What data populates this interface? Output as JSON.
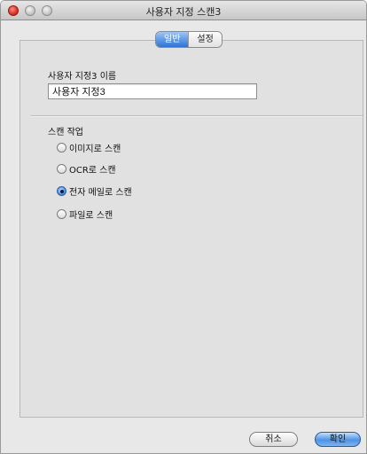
{
  "window": {
    "title": "사용자 지정 스캔3"
  },
  "tabs": [
    {
      "label": "일반",
      "active": true
    },
    {
      "label": "설정",
      "active": false
    }
  ],
  "name_section": {
    "label": "사용자 지정3 이름",
    "value": "사용자 지정3"
  },
  "scan_action": {
    "label": "스캔 작업",
    "options": [
      {
        "label": "이미지로 스캔",
        "checked": false
      },
      {
        "label": "OCR로 스캔",
        "checked": false
      },
      {
        "label": "전자 메일로 스캔",
        "checked": true
      },
      {
        "label": "파일로 스캔",
        "checked": false
      }
    ]
  },
  "buttons": {
    "cancel": "취소",
    "ok": "확인"
  },
  "colors": {
    "accent": "#2b74d6",
    "close": "#d2241a"
  }
}
